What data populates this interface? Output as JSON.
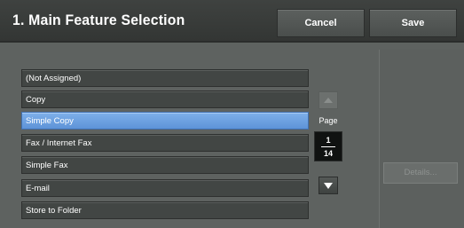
{
  "header": {
    "title": "1. Main Feature Selection",
    "cancel_label": "Cancel",
    "save_label": "Save"
  },
  "list": {
    "items": [
      {
        "label": "(Not Assigned)",
        "selected": false
      },
      {
        "label": "Copy",
        "selected": false
      },
      {
        "label": "Simple Copy",
        "selected": true
      },
      {
        "label": "Fax / Internet Fax",
        "selected": false
      },
      {
        "label": "Simple Fax",
        "selected": false
      },
      {
        "label": "E-mail",
        "selected": false
      },
      {
        "label": "Store to Folder",
        "selected": false
      }
    ]
  },
  "pager": {
    "label": "Page",
    "current": "1",
    "total": "14",
    "scroll_up_icon": "triangle-up-icon",
    "scroll_down_icon": "triangle-down-icon",
    "scroll_up_enabled": false,
    "scroll_down_enabled": true
  },
  "details": {
    "label": "Details...",
    "enabled": false
  },
  "colors": {
    "selected": "#6fa3e2",
    "header": "#3a3d3b",
    "background": "#5e6260"
  }
}
